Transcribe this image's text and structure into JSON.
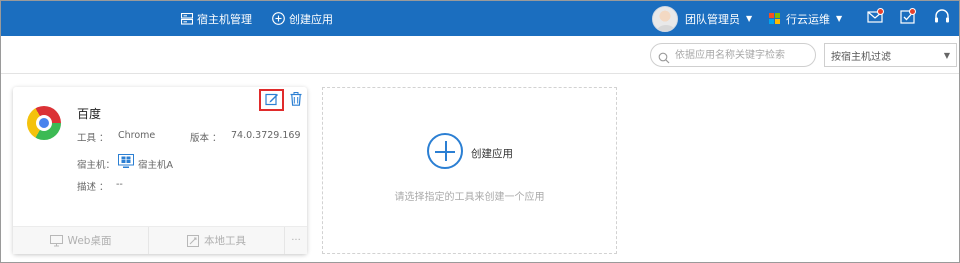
{
  "colors": {
    "topbar_bg": "#1b6ebf",
    "accent": "#2b7fd3",
    "highlight_border": "#e02b2b",
    "notification_dot": "#e8412c"
  },
  "topbar": {
    "host_manage_label": "宿主机管理",
    "host_manage_icon": "server-list-icon",
    "create_app_label": "创建应用",
    "create_app_icon": "plus-circle-icon",
    "user_name": "团队管理员",
    "org_name": "行云运维",
    "icons": [
      "message-icon",
      "task-check-icon",
      "headset-icon"
    ]
  },
  "filter": {
    "search_placeholder": "依据应用名称关键字检索",
    "host_filter_value": "按宿主机过滤"
  },
  "app_card": {
    "name": "百度",
    "tool_label": "工具 ：",
    "tool_value": "Chrome",
    "version_label": "版本 ：",
    "version_value": "74.0.3729.169",
    "host_label": "宿主机：",
    "host_value": "宿主机A",
    "host_icon": "windows-desktop-icon",
    "desc_label": "描述 ：",
    "desc_value": "--",
    "footer": {
      "web_label": "Web桌面",
      "local_label": "本地工具",
      "more_label": "···"
    }
  },
  "create_card": {
    "label": "创建应用",
    "hint": "请选择指定的工具来创建一个应用"
  }
}
